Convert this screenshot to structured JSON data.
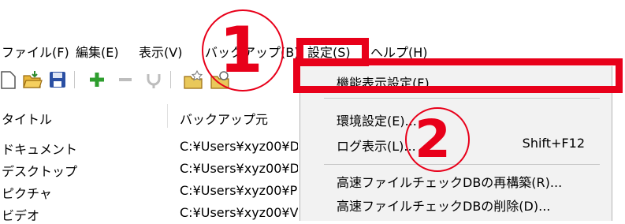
{
  "menubar": {
    "items": [
      "ファイル(F)",
      "編集(E)",
      "表示(V)",
      "バックアップ(B)",
      "設定(S)",
      "ヘルプ(H)"
    ]
  },
  "toolbar": {
    "icons": [
      "new-icon",
      "open-folder-icon",
      "save-icon",
      "add-icon",
      "remove-icon",
      "filter-icon",
      "folder-star-icon",
      "folder-search-icon"
    ]
  },
  "list": {
    "columns": [
      "タイトル",
      "バックアップ元"
    ],
    "rows": [
      {
        "title": "ドキュメント",
        "source": "C:¥Users¥xyz00¥D"
      },
      {
        "title": "デスクトップ",
        "source": "C:¥Users¥xyz00¥D"
      },
      {
        "title": "ピクチャ",
        "source": "C:¥Users¥xyz00¥P"
      },
      {
        "title": "ビデオ",
        "source": "C:¥Users¥xyz00¥V"
      }
    ]
  },
  "dropdown": {
    "items": [
      {
        "label": "機能表示設定(F)...",
        "shortcut": ""
      },
      {
        "label": "環境設定(E)...",
        "shortcut": ""
      },
      {
        "label": "ログ表示(L)...",
        "shortcut": "Shift+F12"
      },
      {
        "label": "高速ファイルチェックDBの再構築(R)...",
        "shortcut": ""
      },
      {
        "label": "高速ファイルチェックDBの削除(D)...",
        "shortcut": ""
      }
    ]
  },
  "annotations": {
    "step1": "1",
    "step2": "2",
    "color": "#e8001a"
  }
}
